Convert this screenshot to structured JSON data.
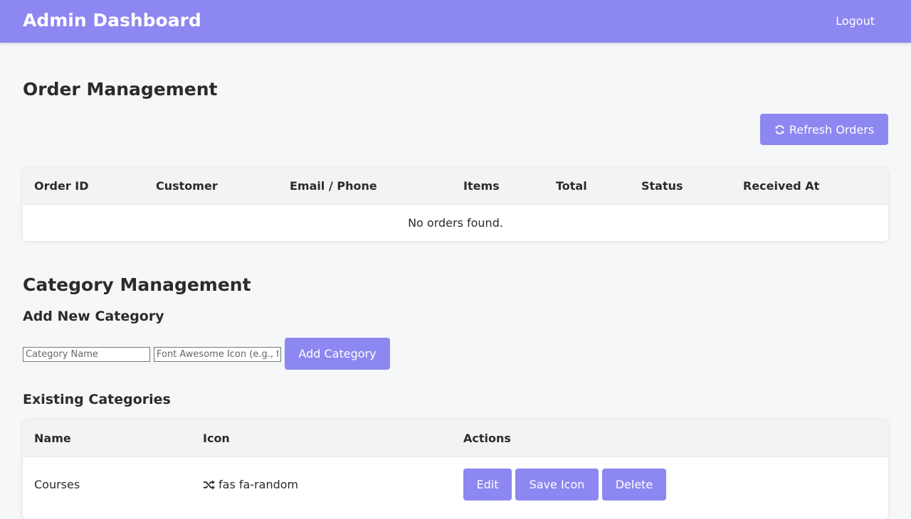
{
  "header": {
    "title": "Admin Dashboard",
    "logout_label": "Logout"
  },
  "orders": {
    "heading": "Order Management",
    "refresh_label": "Refresh Orders",
    "refresh_icon": "sync-icon",
    "columns": [
      "Order ID",
      "Customer",
      "Email / Phone",
      "Items",
      "Total",
      "Status",
      "Received At"
    ],
    "empty_message": "No orders found."
  },
  "categories": {
    "heading": "Category Management",
    "add_heading": "Add New Category",
    "name_placeholder": "Category Name",
    "icon_placeholder": "Font Awesome Icon (e.g., fas fa-book)",
    "add_button_label": "Add Category",
    "existing_heading": "Existing Categories",
    "columns": [
      "Name",
      "Icon",
      "Actions"
    ],
    "rows": [
      {
        "name": "Courses",
        "icon_name": "random-icon",
        "icon_class": "fas fa-random",
        "actions": {
          "edit": "Edit",
          "save_icon": "Save Icon",
          "delete": "Delete"
        }
      }
    ]
  },
  "colors": {
    "accent": "#8d87f1",
    "page_bg": "#f6f7f9",
    "text": "#2b2b2b"
  }
}
